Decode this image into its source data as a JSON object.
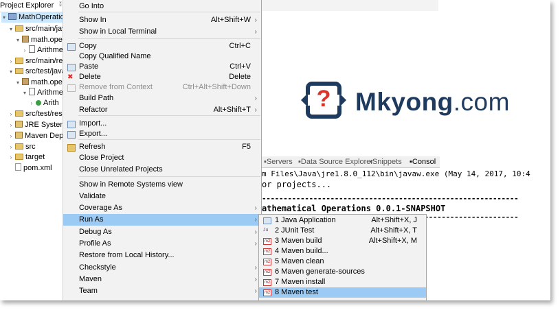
{
  "project_explorer": {
    "title": "Project Explorer",
    "tree": [
      {
        "label": "MathOperation",
        "icon": "project-icon"
      },
      {
        "label": "src/main/java",
        "icon": "folder-icon"
      },
      {
        "label": "math.oper",
        "icon": "package-icon"
      },
      {
        "label": "Arithme",
        "icon": "java-file-icon"
      },
      {
        "label": "src/main/reso",
        "icon": "folder-icon"
      },
      {
        "label": "src/test/java",
        "icon": "folder-icon"
      },
      {
        "label": "math.oper",
        "icon": "package-icon"
      },
      {
        "label": "Arithme",
        "icon": "java-file-icon"
      },
      {
        "label": "Arith",
        "icon": "class-icon"
      },
      {
        "label": "src/test/reso",
        "icon": "folder-icon"
      },
      {
        "label": "JRE System",
        "icon": "library-icon"
      },
      {
        "label": "Maven Depe",
        "icon": "library-icon"
      },
      {
        "label": "src",
        "icon": "folder-icon"
      },
      {
        "label": "target",
        "icon": "folder-icon"
      },
      {
        "label": "pom.xml",
        "icon": "xml-file-icon"
      }
    ]
  },
  "context_menu": {
    "items": [
      {
        "label": "Go Into",
        "shortcut": "",
        "submenu": false
      },
      {
        "label": "Show In",
        "shortcut": "Alt+Shift+W",
        "submenu": true
      },
      {
        "label": "Show in Local Terminal",
        "shortcut": "",
        "submenu": true
      },
      {
        "label": "Copy",
        "shortcut": "Ctrl+C",
        "submenu": false
      },
      {
        "label": "Copy Qualified Name",
        "shortcut": "",
        "submenu": false
      },
      {
        "label": "Paste",
        "shortcut": "Ctrl+V",
        "submenu": false
      },
      {
        "label": "Delete",
        "shortcut": "Delete",
        "submenu": false
      },
      {
        "label": "Remove from Context",
        "shortcut": "Ctrl+Alt+Shift+Down",
        "submenu": false
      },
      {
        "label": "Build Path",
        "shortcut": "",
        "submenu": true
      },
      {
        "label": "Refactor",
        "shortcut": "Alt+Shift+T",
        "submenu": true
      },
      {
        "label": "Import...",
        "shortcut": "",
        "submenu": false
      },
      {
        "label": "Export...",
        "shortcut": "",
        "submenu": false
      },
      {
        "label": "Refresh",
        "shortcut": "F5",
        "submenu": false
      },
      {
        "label": "Close Project",
        "shortcut": "",
        "submenu": false
      },
      {
        "label": "Close Unrelated Projects",
        "shortcut": "",
        "submenu": false
      },
      {
        "label": "Show in Remote Systems view",
        "shortcut": "",
        "submenu": false
      },
      {
        "label": "Validate",
        "shortcut": "",
        "submenu": false
      },
      {
        "label": "Coverage As",
        "shortcut": "",
        "submenu": true
      },
      {
        "label": "Run As",
        "shortcut": "",
        "submenu": true
      },
      {
        "label": "Debug As",
        "shortcut": "",
        "submenu": true
      },
      {
        "label": "Profile As",
        "shortcut": "",
        "submenu": true
      },
      {
        "label": "Restore from Local History...",
        "shortcut": "",
        "submenu": false
      },
      {
        "label": "Checkstyle",
        "shortcut": "",
        "submenu": true
      },
      {
        "label": "Maven",
        "shortcut": "",
        "submenu": true
      },
      {
        "label": "Team",
        "shortcut": "",
        "submenu": true
      }
    ]
  },
  "run_as_submenu": {
    "items": [
      {
        "label": "1 Java Application",
        "shortcut": "Alt+Shift+X, J",
        "icon": "java-app-icon"
      },
      {
        "label": "2 JUnit Test",
        "shortcut": "Alt+Shift+X, T",
        "icon": "junit-icon"
      },
      {
        "label": "3 Maven build",
        "shortcut": "Alt+Shift+X, M",
        "icon": "maven-icon"
      },
      {
        "label": "4 Maven build...",
        "shortcut": "",
        "icon": "maven-icon"
      },
      {
        "label": "5 Maven clean",
        "shortcut": "",
        "icon": "maven-icon"
      },
      {
        "label": "6 Maven generate-sources",
        "shortcut": "",
        "icon": "maven-icon"
      },
      {
        "label": "7 Maven install",
        "shortcut": "",
        "icon": "maven-icon"
      },
      {
        "label": "8 Maven test",
        "shortcut": "",
        "icon": "maven-icon"
      }
    ]
  },
  "logo": {
    "brand": "Mkyong",
    "suffix": ".com",
    "accent": "#d9342b",
    "brand_color": "#1e3a5f"
  },
  "console": {
    "tabs": [
      "Servers",
      "Data Source Explorer",
      "Snippets",
      "Consol"
    ],
    "lines": [
      "m Files\\Java\\jre1.8.0_112\\bin\\javaw.exe (May 14, 2017, 10:4",
      "or projects...",
      "------------------------------------------------------------",
      "athematical Operations 0.0.1-SNAPSHOT",
      "------------------------------------------------------------"
    ]
  }
}
